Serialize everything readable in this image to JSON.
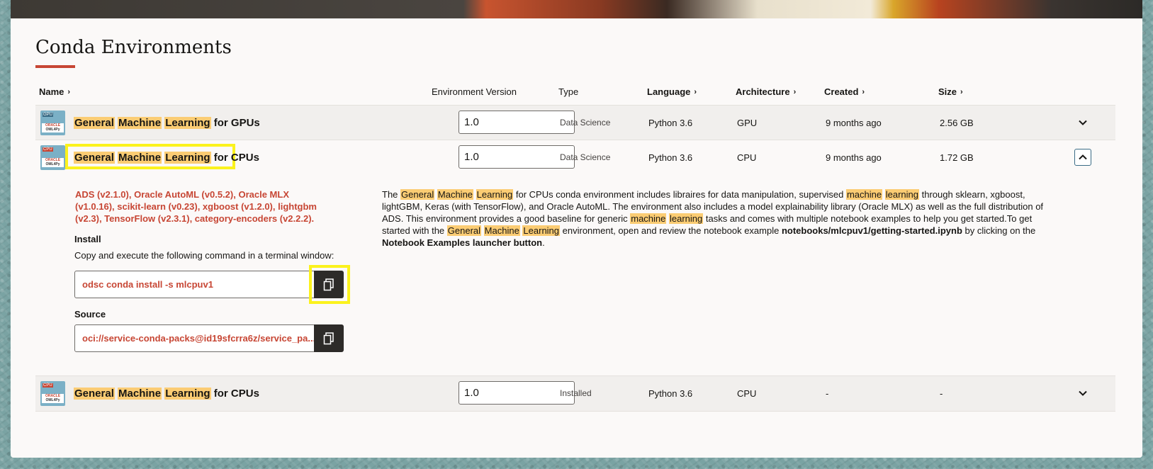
{
  "page": {
    "title": "Conda Environments"
  },
  "columns": {
    "name": "Name",
    "version": "Environment Version",
    "type": "Type",
    "language": "Language",
    "architecture": "Architecture",
    "created": "Created",
    "size": "Size"
  },
  "rows": [
    {
      "badge": "GPU",
      "brand": "ORACLE",
      "brand_sub": "OML4Py",
      "name_parts": [
        "General",
        "Machine",
        "Learning",
        "for GPUs"
      ],
      "version": "1.0",
      "type": "Data Science",
      "language": "Python 3.6",
      "architecture": "GPU",
      "created": "9 months ago",
      "size": "2.56 GB"
    },
    {
      "badge": "CPU",
      "brand": "ORACLE",
      "brand_sub": "OML4Py",
      "name_parts": [
        "General",
        "Machine",
        "Learning",
        "for CPUs"
      ],
      "version": "1.0",
      "type": "Data Science",
      "language": "Python 3.6",
      "architecture": "CPU",
      "created": "9 months ago",
      "size": "1.72 GB"
    },
    {
      "badge": "CPU",
      "brand": "ORACLE",
      "brand_sub": "OML4Py",
      "name_parts": [
        "General",
        "Machine",
        "Learning",
        "for CPUs"
      ],
      "version": "1.0",
      "type": "Installed",
      "language": "Python 3.6",
      "architecture": "CPU",
      "created": "-",
      "size": "-"
    }
  ],
  "details": {
    "libraries": "ADS (v2.1.0), Oracle AutoML (v0.5.2), Oracle MLX (v1.0.16), scikit-learn (v0.23), xgboost (v1.2.0), lightgbm (v2.3), TensorFlow (v2.3.1), category-encoders (v2.2.2).",
    "install_label": "Install",
    "install_hint": "Copy and execute the following command in a terminal window:",
    "install_command": "odsc conda install -s mlcpuv1",
    "source_label": "Source",
    "source_value": "oci://service-conda-packs@id19sfcrra6z/service_pa...",
    "desc": {
      "t1": "The ",
      "h1": "General",
      "h2": "Machine",
      "h3": "Learning",
      "t2": " for CPUs conda environment includes libraires for data manipulation, supervised ",
      "h4": "machine",
      "h5": "learning",
      "t3": " through sklearn, xgboost, lightGBM, Keras (with TensorFlow), and Oracle AutoML. The environment also includes a model explainability library (Oracle MLX) as well as the full distribution of ADS. This environment provides a good baseline for generic ",
      "h6": "machine",
      "h7": "learning",
      "t4": " tasks and comes with multiple notebook examples to help you get started.To get started with the ",
      "h8": "General",
      "h9": "Machine",
      "h10": "Learning",
      "t5": " environment, open and review the notebook example ",
      "b1": "notebooks/mlcpuv1/getting-started.ipynb",
      "t6": " by clicking on the ",
      "b2": "Notebook Examples launcher button",
      "t7": "."
    }
  },
  "icons": {
    "sort": "chevron-right-icon",
    "expand": "chevron-down-icon",
    "collapse": "chevron-up-icon",
    "copy": "copy-icon"
  },
  "colors": {
    "accent": "#c74634",
    "highlight": "#fbcc73",
    "focus_box": "#fbf21d",
    "button_dark": "#2d2b29"
  }
}
